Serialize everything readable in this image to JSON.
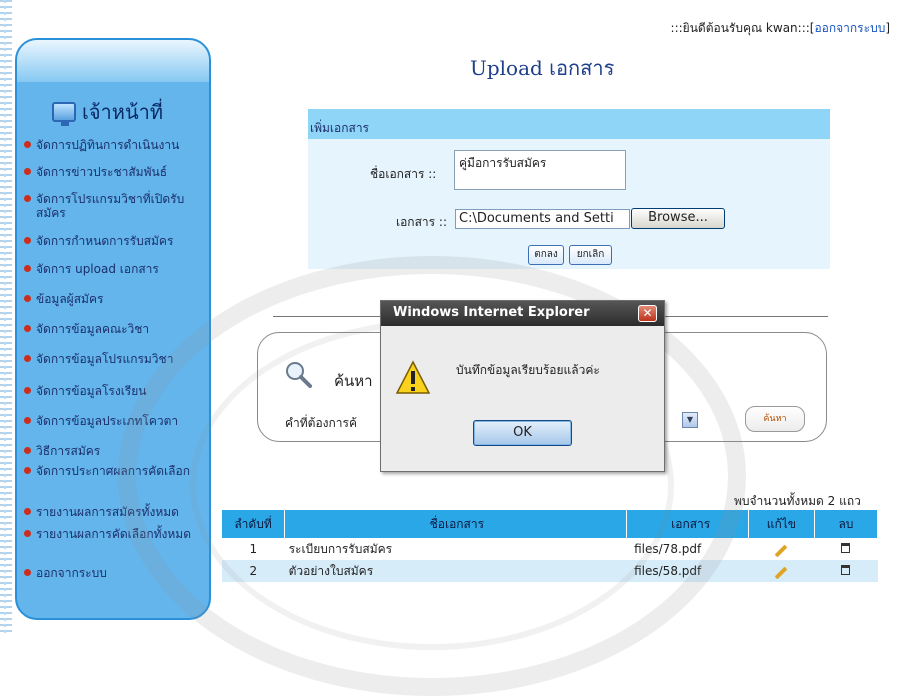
{
  "header": {
    "welcome_prefix": ":::ยินดีต้อนรับคุณ kwan:::[",
    "logout_link": "ออกจากระบบ",
    "welcome_suffix": "]"
  },
  "page_title": "Upload เอกสาร",
  "sidebar": {
    "title": "เจ้าหน้าที่",
    "items": [
      {
        "label": "จัดการปฏิทินการดำเนินงาน"
      },
      {
        "label": "จัดการข่าวประชาสัมพันธ์"
      },
      {
        "label": "จัดการโปรแกรมวิชาที่เปิดรับสมัคร"
      },
      {
        "label": "จัดการกำหนดการรับสมัคร"
      },
      {
        "label": "จัดการ upload เอกสาร"
      },
      {
        "label": "ข้อมูลผู้สมัคร"
      },
      {
        "label": "จัดการข้อมูลคณะวิชา"
      },
      {
        "label": "จัดการข้อมูลโปรแกรมวิชา"
      },
      {
        "label": "จัดการข้อมูลโรงเรียน"
      },
      {
        "label": "จัดการข้อมูลประเภทโควตา"
      },
      {
        "label": "วิธีการสมัคร"
      },
      {
        "label": "จัดการประกาศผลการคัดเลือก"
      },
      {
        "label": "รายงานผลการสมัครทั้งหมด"
      },
      {
        "label": "รายงานผลการคัดเลือกทั้งหมด"
      },
      {
        "label": "ออกจากระบบ"
      }
    ]
  },
  "upload_form": {
    "section_title": "เพิ่มเอกสาร",
    "name_label": "ชื่อเอกสาร ::",
    "name_value": "คู่มือการรับสมัคร",
    "file_label": "เอกสาร ::",
    "file_value": "C:\\Documents and Setti",
    "browse_label": "Browse...",
    "submit_label": "ตกลง",
    "cancel_label": "ยกเลิก"
  },
  "search": {
    "title": "ค้นหา",
    "field_label": "คำที่ต้องการค้",
    "button_label": "ค้นหา"
  },
  "dialog": {
    "title": "Windows Internet Explorer",
    "message": "บันทึกข้อมูลเรียบร้อยแล้วค่ะ",
    "ok_label": "OK"
  },
  "results": {
    "found_text": "พบจำนวนทั้งหมด  2 แถว",
    "columns": [
      "ลำดับที่",
      "ชื่อเอกสาร",
      "เอกสาร",
      "แก้ไข",
      "ลบ"
    ],
    "rows": [
      {
        "no": "1",
        "name": "ระเบียบการรับสมัคร",
        "file": "files/78.pdf"
      },
      {
        "no": "2",
        "name": "ตัวอย่างใบสมัคร",
        "file": "files/58.pdf"
      }
    ]
  },
  "colors": {
    "sidebar_bg": "#63b5ec",
    "table_header_bg": "#2aa7e6",
    "upload_header_bg": "#8ed5f7",
    "dialog_titlebar": "#3c3c3c"
  }
}
